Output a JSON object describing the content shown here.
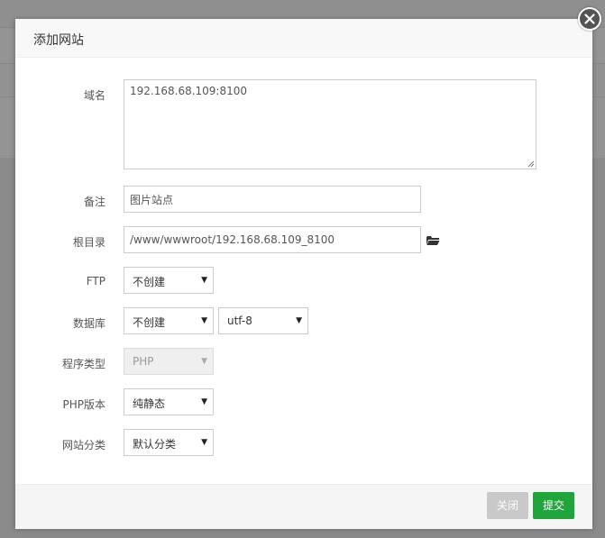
{
  "dialog": {
    "title": "添加网站"
  },
  "form": {
    "domain": {
      "label": "域名",
      "value": "192.168.68.109:8100"
    },
    "remark": {
      "label": "备注",
      "value": "图片站点"
    },
    "root": {
      "label": "根目录",
      "value": "/www/wwwroot/192.168.68.109_8100"
    },
    "ftp": {
      "label": "FTP",
      "selected": "不创建"
    },
    "database": {
      "label": "数据库",
      "selected": "不创建",
      "charset": "utf-8"
    },
    "program_type": {
      "label": "程序类型",
      "selected": "PHP",
      "disabled": true
    },
    "php_version": {
      "label": "PHP版本",
      "selected": "纯静态"
    },
    "category": {
      "label": "网站分类",
      "selected": "默认分类"
    }
  },
  "footer": {
    "close_label": "关闭",
    "submit_label": "提交"
  },
  "colors": {
    "submit": "#20a53a",
    "close_disabled": "#c9c9c9",
    "close_icon_bg": "#545454"
  },
  "icons": {
    "close": "close-icon",
    "folder": "folder-open-icon",
    "dropdown": "caret-down-icon"
  }
}
